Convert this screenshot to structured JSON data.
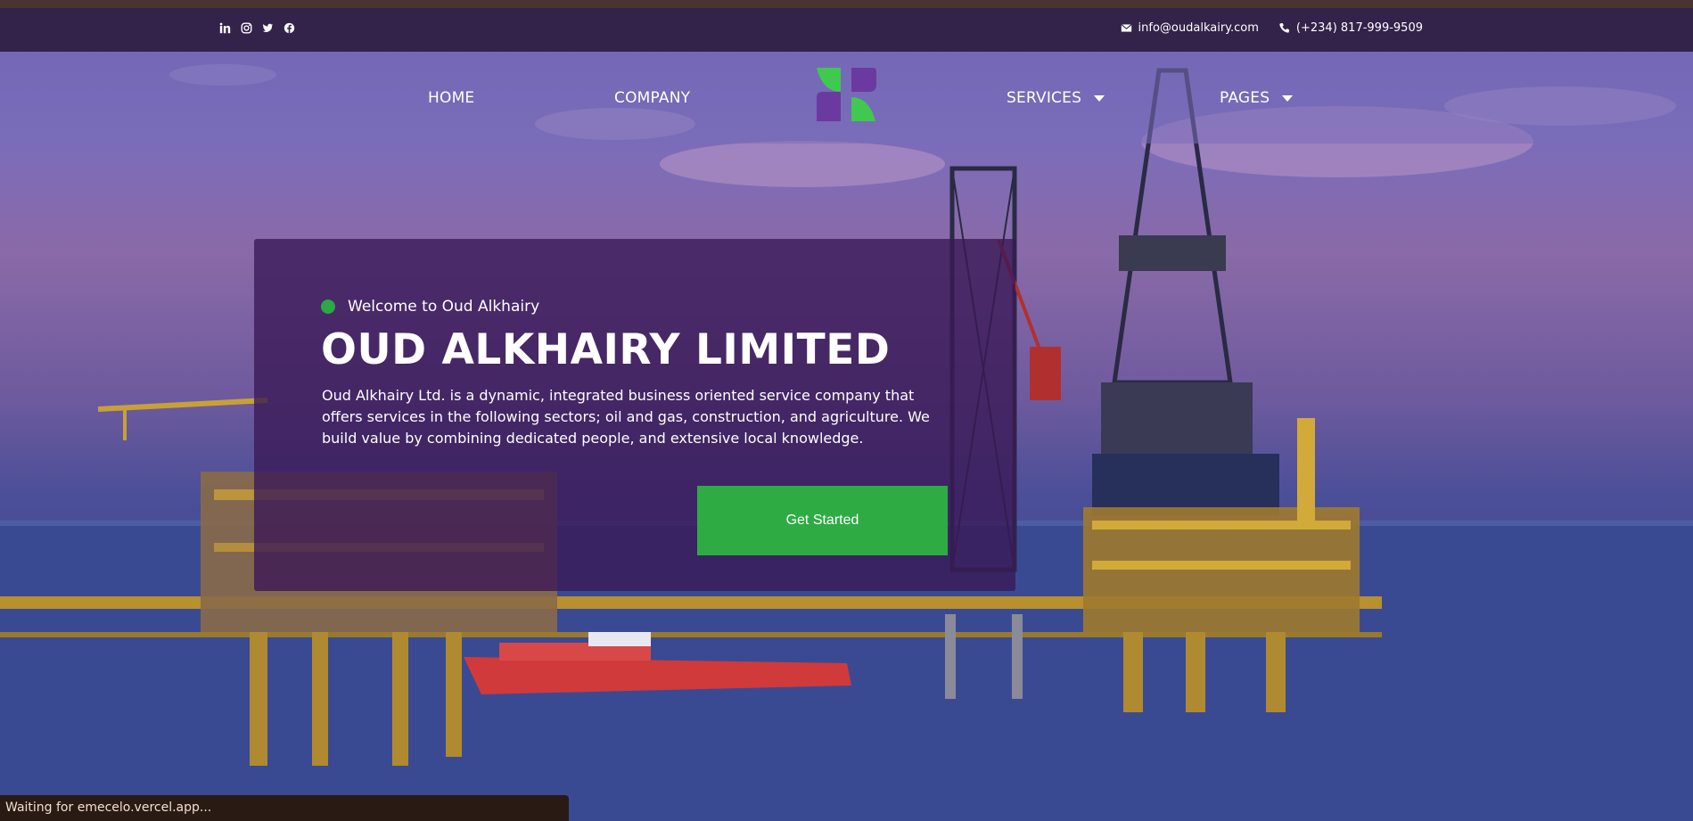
{
  "topbar": {
    "social_icons": [
      "linkedin-icon",
      "instagram-icon",
      "twitter-icon",
      "facebook-icon"
    ],
    "email": "info@oudalkairy.com",
    "phone": "(+234) 817-999-9509"
  },
  "nav": {
    "home": "HOME",
    "company": "COMPANY",
    "services": "SERVICES",
    "pages": "PAGES"
  },
  "hero": {
    "welcome": "Welcome to Oud Alkhairy",
    "title": "OUD ALKHAIRY LIMITED",
    "description": "Oud Alkhairy Ltd. is a dynamic, integrated business oriented service company that offers services in the following sectors; oil and gas, construction, and agriculture. We build value by combining dedicated people, and extensive local knowledge.",
    "cta": "Get Started"
  },
  "status_bar": "Waiting for emecelo.vercel.app...",
  "colors": {
    "topbar": "#33224a",
    "accent_green": "#2eac43",
    "card": "#3a1856"
  }
}
